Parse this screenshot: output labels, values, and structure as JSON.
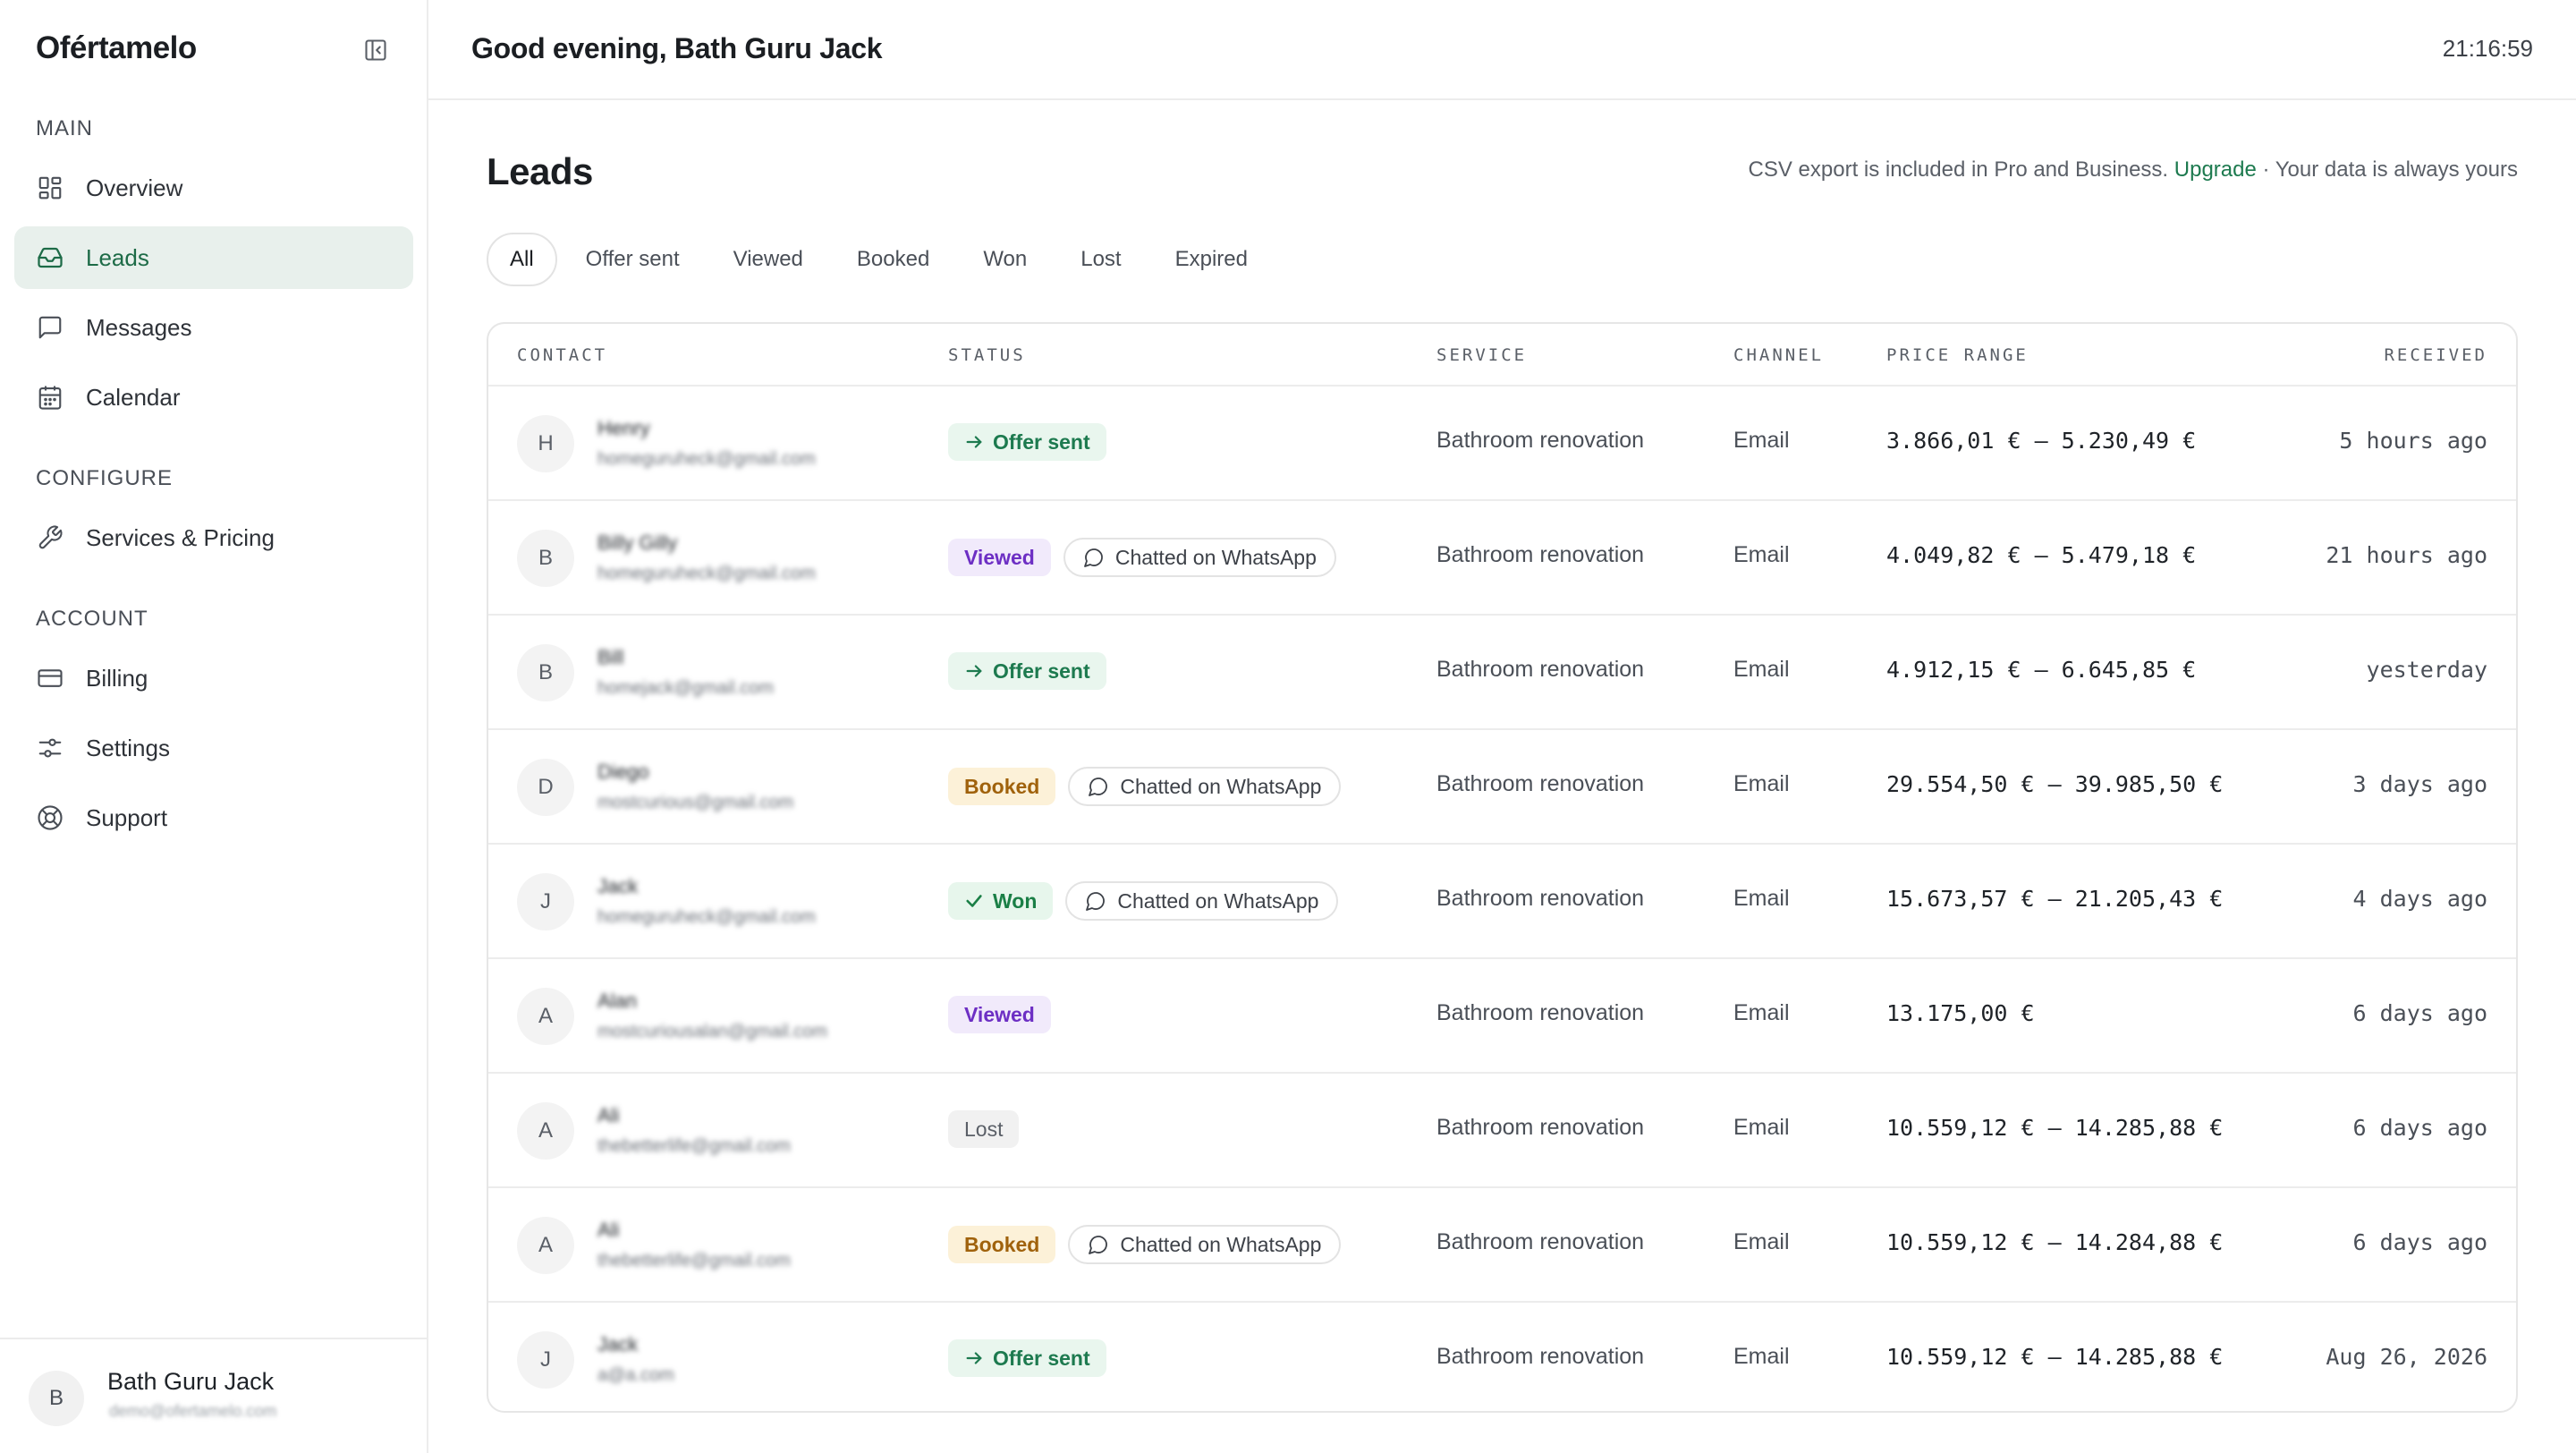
{
  "app": {
    "brand": "Ofértamelo"
  },
  "sidebar": {
    "sections": {
      "main": "MAIN",
      "configure": "CONFIGURE",
      "account": "ACCOUNT"
    },
    "items": [
      {
        "label": "Overview",
        "icon": "grid-icon",
        "active": false
      },
      {
        "label": "Leads",
        "icon": "inbox-icon",
        "active": true
      },
      {
        "label": "Messages",
        "icon": "message-square-icon",
        "active": false
      },
      {
        "label": "Calendar",
        "icon": "calendar-icon",
        "active": false
      },
      {
        "label": "Services & Pricing",
        "icon": "wrench-icon",
        "active": false
      },
      {
        "label": "Billing",
        "icon": "credit-card-icon",
        "active": false
      },
      {
        "label": "Settings",
        "icon": "sliders-icon",
        "active": false
      },
      {
        "label": "Support",
        "icon": "life-buoy-icon",
        "active": false
      }
    ],
    "footer": {
      "avatar_initial": "B",
      "name": "Bath Guru Jack",
      "email": "demo@ofertamelo.com"
    }
  },
  "header": {
    "greeting": "Good evening, Bath Guru Jack",
    "clock": "21:16:59"
  },
  "page": {
    "title": "Leads",
    "csv_note_prefix": "CSV export is included in Pro and Business.",
    "csv_note_link": "Upgrade",
    "csv_note_suffix": "· Your data is always yours"
  },
  "tabs": [
    {
      "label": "All",
      "active": true
    },
    {
      "label": "Offer sent",
      "active": false
    },
    {
      "label": "Viewed",
      "active": false
    },
    {
      "label": "Booked",
      "active": false
    },
    {
      "label": "Won",
      "active": false
    },
    {
      "label": "Lost",
      "active": false
    },
    {
      "label": "Expired",
      "active": false
    }
  ],
  "table": {
    "columns": {
      "contact": "CONTACT",
      "status": "STATUS",
      "service": "SERVICE",
      "channel": "CHANNEL",
      "price_range": "PRICE RANGE",
      "received": "RECEIVED"
    },
    "rows": [
      {
        "initial": "H",
        "name": "Henry",
        "email": "homeguruheck@gmail.com",
        "status": "Offer sent",
        "chat": "",
        "service": "Bathroom renovation",
        "channel": "Email",
        "price": "3.866,01 € – 5.230,49 €",
        "received": "5 hours ago"
      },
      {
        "initial": "B",
        "name": "Billy Gilly",
        "email": "homeguruheck@gmail.com",
        "status": "Viewed",
        "chat": "Chatted on WhatsApp",
        "service": "Bathroom renovation",
        "channel": "Email",
        "price": "4.049,82 € – 5.479,18 €",
        "received": "21 hours ago"
      },
      {
        "initial": "B",
        "name": "Bill",
        "email": "homejack@gmail.com",
        "status": "Offer sent",
        "chat": "",
        "service": "Bathroom renovation",
        "channel": "Email",
        "price": "4.912,15 € – 6.645,85 €",
        "received": "yesterday"
      },
      {
        "initial": "D",
        "name": "Diego",
        "email": "mostcurious@gmail.com",
        "status": "Booked",
        "chat": "Chatted on WhatsApp",
        "service": "Bathroom renovation",
        "channel": "Email",
        "price": "29.554,50 € – 39.985,50 €",
        "received": "3 days ago"
      },
      {
        "initial": "J",
        "name": "Jack",
        "email": "homeguruheck@gmail.com",
        "status": "Won",
        "chat": "Chatted on WhatsApp",
        "service": "Bathroom renovation",
        "channel": "Email",
        "price": "15.673,57 € – 21.205,43 €",
        "received": "4 days ago"
      },
      {
        "initial": "A",
        "name": "Alan",
        "email": "mostcuriousalan@gmail.com",
        "status": "Viewed",
        "chat": "",
        "service": "Bathroom renovation",
        "channel": "Email",
        "price": "13.175,00 €",
        "received": "6 days ago"
      },
      {
        "initial": "A",
        "name": "Ali",
        "email": "thebetterlife@gmail.com",
        "status": "Lost",
        "chat": "",
        "service": "Bathroom renovation",
        "channel": "Email",
        "price": "10.559,12 € – 14.285,88 €",
        "received": "6 days ago"
      },
      {
        "initial": "A",
        "name": "Ali",
        "email": "thebetterlife@gmail.com",
        "status": "Booked",
        "chat": "Chatted on WhatsApp",
        "service": "Bathroom renovation",
        "channel": "Email",
        "price": "10.559,12 € – 14.284,88 €",
        "received": "6 days ago"
      },
      {
        "initial": "J",
        "name": "Jack",
        "email": "a@a.com",
        "status": "Offer sent",
        "chat": "",
        "service": "Bathroom renovation",
        "channel": "Email",
        "price": "10.559,12 € – 14.285,88 €",
        "received": "Aug 26, 2026"
      }
    ]
  },
  "colors": {
    "accent": "#1d7a4f",
    "active_nav_bg": "#e8f0ec",
    "offer_bg": "#e9f6ee",
    "viewed_bg": "#f1eafb",
    "viewed_fg": "#6d2fc4",
    "booked_bg": "#fcf1d8",
    "booked_fg": "#a0620c",
    "lost_bg": "#f1f1f1"
  }
}
